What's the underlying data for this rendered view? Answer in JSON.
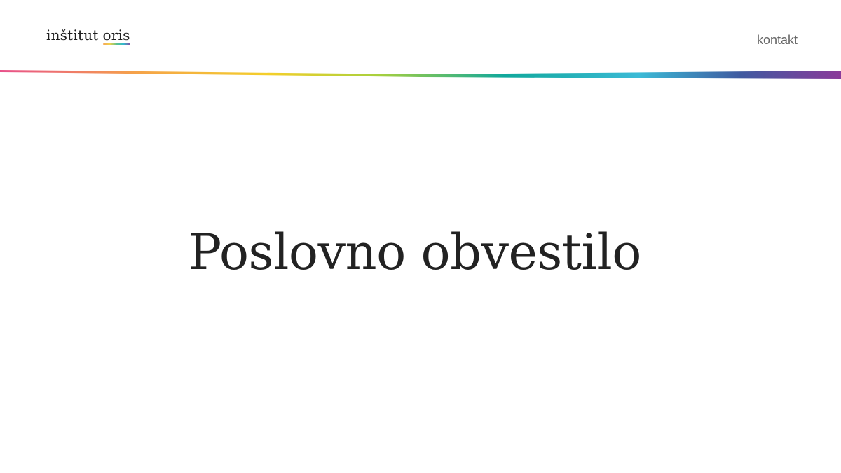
{
  "header": {
    "logo_word_1": "inštitut",
    "logo_word_2": "oris",
    "nav_contact": "kontakt"
  },
  "hero": {
    "title": "Poslovno obvestilo"
  },
  "colors": {
    "background": "#ffffff",
    "text": "#222222",
    "nav_text": "#666666",
    "rainbow_stops": [
      "#e8508a",
      "#f5a24a",
      "#f4cf2a",
      "#a8d03d",
      "#10a89c",
      "#3bbad6",
      "#3f5aa0",
      "#8a3a9a"
    ]
  }
}
